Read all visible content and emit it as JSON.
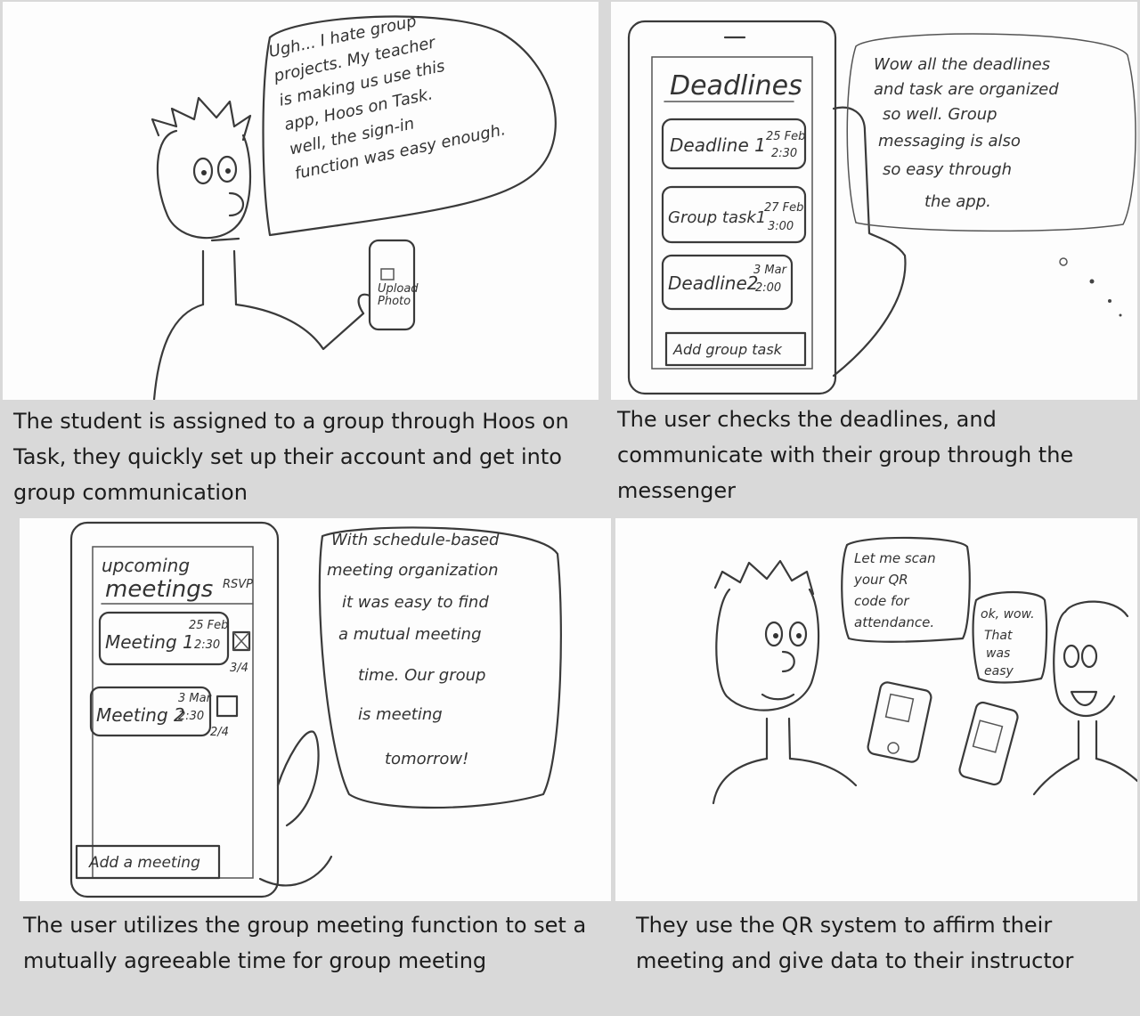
{
  "panels": [
    {
      "speech": [
        "Ugh... I hate group",
        "projects. My teacher",
        "is making us use this",
        "app, Hoos on Task.",
        "well, the sign-in",
        "function was easy enough."
      ],
      "phone_screen": [
        "Upload",
        "Photo"
      ],
      "caption": "The student is assigned to a group through Hoos on Task, they quickly set up their account and get into group communication"
    },
    {
      "screen_title": "Deadlines",
      "items": [
        {
          "label": "Deadline 1",
          "date": "25 Feb",
          "time": "2:30"
        },
        {
          "label": "Group task1",
          "date": "27 Feb",
          "time": "3:00"
        },
        {
          "label": "Deadline2",
          "date": "3 Mar",
          "time": "2:00"
        }
      ],
      "button": "Add group task",
      "thought": [
        "Wow all the deadlines",
        "and task are organized",
        "so well. Group",
        "messaging is also",
        "so easy through",
        "the app."
      ],
      "caption": "The user checks the deadlines, and communicate with their group through the messenger"
    },
    {
      "screen_title_1": "upcoming",
      "screen_title_2": "meetings",
      "rsvp": "RSVP",
      "items": [
        {
          "label": "Meeting 1",
          "date": "25 Feb",
          "time": "2:30",
          "count": "3/4"
        },
        {
          "label": "Meeting 2",
          "date": "3 Mar",
          "time": "2:30",
          "count": "2/4"
        }
      ],
      "button": "Add a meeting",
      "speech": [
        "With schedule-based",
        "meeting organization",
        "it was easy to find",
        "a mutual meeting",
        "time. Our group",
        "is meeting",
        "tomorrow!"
      ],
      "caption": "The user utilizes the group meeting function to set a mutually agreeable time for group meeting"
    },
    {
      "speech_a": [
        "Let me scan",
        "your QR",
        "code for",
        "attendance."
      ],
      "speech_b": [
        "ok, wow.",
        "That",
        "was",
        "easy"
      ],
      "caption": "They use the QR system to affirm their meeting and give data to their instructor"
    }
  ]
}
